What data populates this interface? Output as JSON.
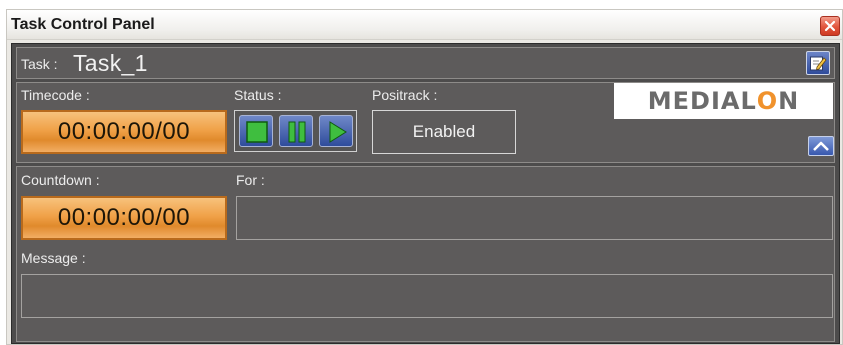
{
  "window": {
    "title": "Task Control Panel"
  },
  "task": {
    "label": "Task :",
    "name": "Task_1"
  },
  "timecode": {
    "label": "Timecode :",
    "value": "00:00:00/00"
  },
  "status": {
    "label": "Status :",
    "buttons": [
      "stop-icon",
      "pause-icon",
      "play-icon"
    ]
  },
  "positrack": {
    "label": "Positrack :",
    "value": "Enabled"
  },
  "logo": {
    "text_start": "MEDIAL",
    "text_accent": "O",
    "text_end": "N"
  },
  "countdown": {
    "label": "Countdown :",
    "value": "00:00:00/00"
  },
  "for": {
    "label": "For :",
    "value": ""
  },
  "message": {
    "label": "Message :",
    "value": ""
  },
  "colors": {
    "accent_orange": "#f0a148",
    "button_blue": "#2f4c9c",
    "panel_bg": "#5d5b5b"
  }
}
